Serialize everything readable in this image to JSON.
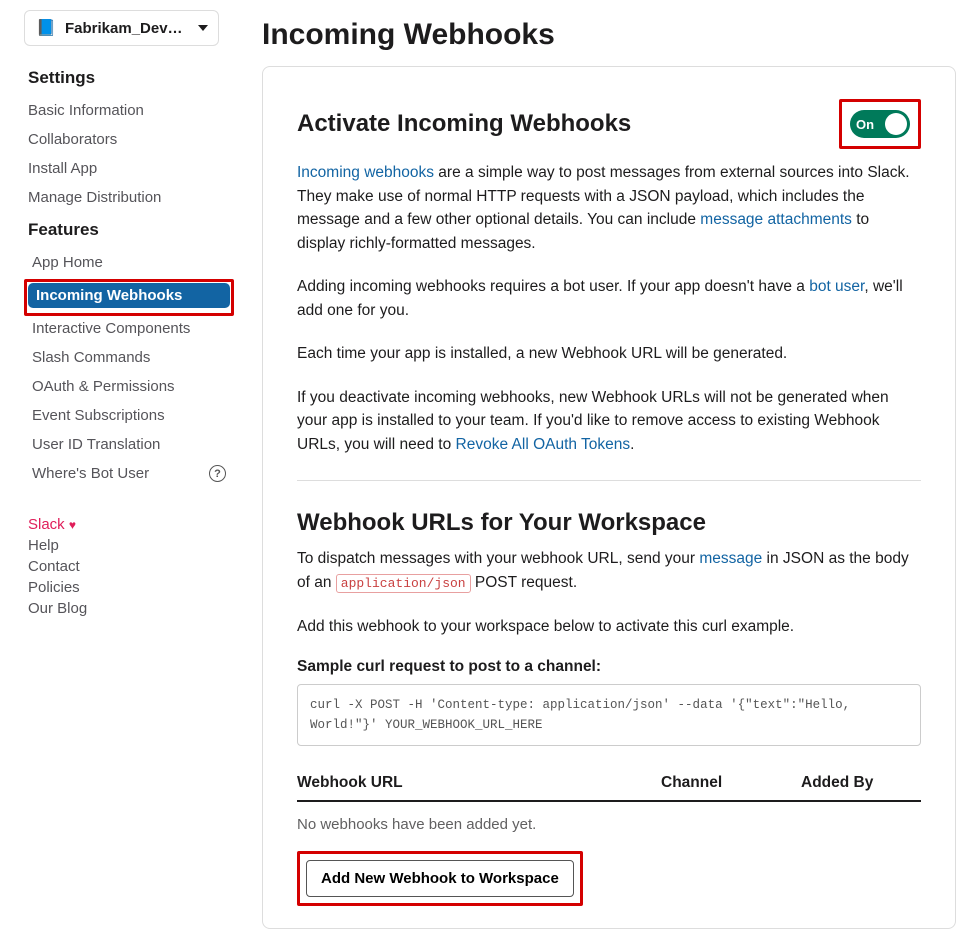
{
  "app_selector": {
    "name": "Fabrikam_Dev…",
    "icon": "📘"
  },
  "sidebar": {
    "settings_label": "Settings",
    "settings_items": [
      "Basic Information",
      "Collaborators",
      "Install App",
      "Manage Distribution"
    ],
    "features_label": "Features",
    "features_items": [
      "App Home",
      "Incoming Webhooks",
      "Interactive Components",
      "Slash Commands",
      "OAuth & Permissions",
      "Event Subscriptions",
      "User ID Translation",
      "Where's Bot User"
    ],
    "footer": {
      "slack": "Slack",
      "help": "Help",
      "contact": "Contact",
      "policies": "Policies",
      "blog": "Our Blog"
    }
  },
  "page": {
    "title": "Incoming Webhooks"
  },
  "activate": {
    "heading": "Activate Incoming Webhooks",
    "toggle_label": "On",
    "p1_link": "Incoming webhooks",
    "p1_a": " are a simple way to post messages from external sources into Slack. They make use of normal HTTP requests with a JSON payload, which includes the message and a few other optional details. You can include ",
    "p1_link2": "message attachments",
    "p1_b": " to display richly-formatted messages.",
    "p2_a": "Adding incoming webhooks requires a bot user. If your app doesn't have a ",
    "p2_link": "bot user",
    "p2_b": ", we'll add one for you.",
    "p3": "Each time your app is installed, a new Webhook URL will be generated.",
    "p4_a": "If you deactivate incoming webhooks, new Webhook URLs will not be generated when your app is installed to your team. If you'd like to remove access to existing Webhook URLs, you will need to ",
    "p4_link": "Revoke All OAuth Tokens",
    "p4_b": "."
  },
  "urls": {
    "heading": "Webhook URLs for Your Workspace",
    "p1_a": "To dispatch messages with your webhook URL, send your ",
    "p1_link": "message",
    "p1_b": " in JSON as the body of an ",
    "p1_code": "application/json",
    "p1_c": " POST request.",
    "p2": "Add this webhook to your workspace below to activate this curl example.",
    "sample_label": "Sample curl request to post to a channel:",
    "sample_code": "curl -X POST -H 'Content-type: application/json' --data '{\"text\":\"Hello, World!\"}' YOUR_WEBHOOK_URL_HERE",
    "table": {
      "col1": "Webhook URL",
      "col2": "Channel",
      "col3": "Added By"
    },
    "empty": "No webhooks have been added yet.",
    "add_button": "Add New Webhook to Workspace"
  }
}
